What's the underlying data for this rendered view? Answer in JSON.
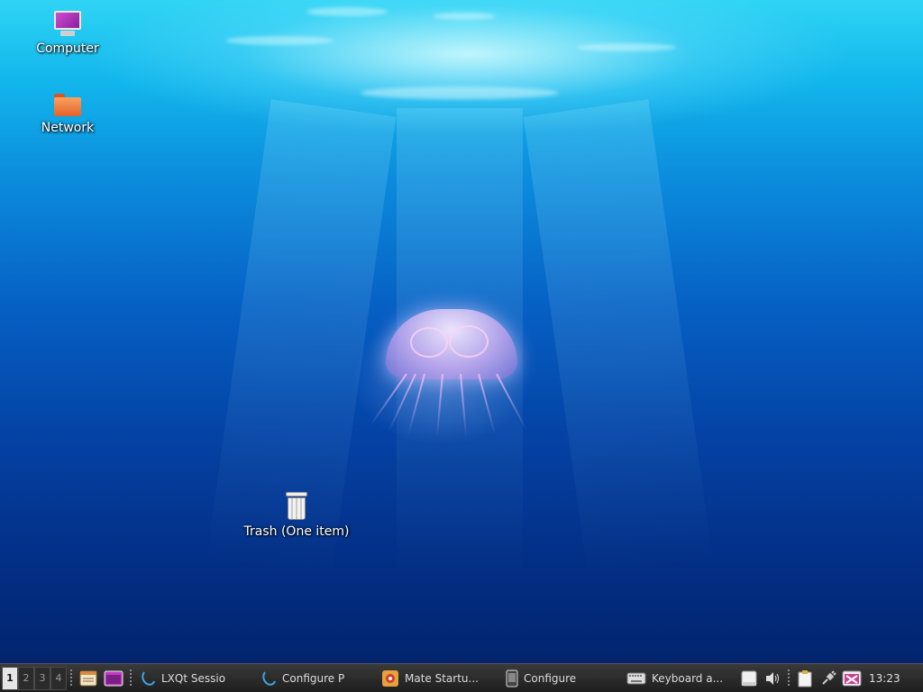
{
  "desktop": {
    "icons": [
      {
        "label": "Computer",
        "icon": "computer-icon"
      },
      {
        "label": "Network",
        "icon": "network-folder-icon"
      },
      {
        "label": "Trash (One item)",
        "icon": "trash-icon"
      }
    ]
  },
  "taskbar": {
    "workspaces": [
      "1",
      "2",
      "3",
      "4"
    ],
    "active_workspace": "1",
    "quicklaunch": [
      {
        "icon": "file-manager-icon"
      },
      {
        "icon": "terminal-icon"
      }
    ],
    "tasks": [
      {
        "label": "LXQt Sessio",
        "icon": "lxqt-icon"
      },
      {
        "label": "Configure P",
        "icon": "lxqt-icon"
      },
      {
        "label": "Mate Startu...",
        "icon": "startup-apps-icon"
      },
      {
        "label": "Configure",
        "icon": "mobile-device-icon"
      },
      {
        "label": "Keyboard a...",
        "icon": "keyboard-icon"
      }
    ],
    "tray": [
      {
        "icon": "removable-drive-icon"
      },
      {
        "icon": "volume-icon"
      },
      {
        "icon": "clipboard-icon"
      },
      {
        "icon": "network-plug-icon"
      },
      {
        "icon": "update-notifier-icon"
      }
    ],
    "clock": "13:23"
  }
}
